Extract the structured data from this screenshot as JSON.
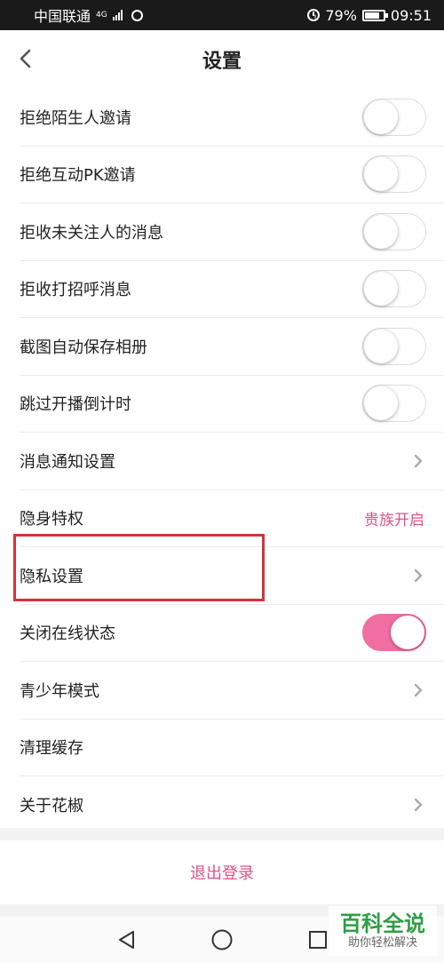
{
  "status_bar": {
    "carrier": "中国联通",
    "network": "4G",
    "battery": "79%",
    "battery_level": 0.79,
    "time": "09:51"
  },
  "header": {
    "title": "设置",
    "back_icon": "chevron-left-icon"
  },
  "settings": [
    {
      "label": "拒绝陌生人邀请",
      "control": "toggle",
      "on": false
    },
    {
      "label": "拒绝互动PK邀请",
      "control": "toggle",
      "on": false
    },
    {
      "label": "拒收未关注人的消息",
      "control": "toggle",
      "on": false
    },
    {
      "label": "拒收打招呼消息",
      "control": "toggle",
      "on": false
    },
    {
      "label": "截图自动保存相册",
      "control": "toggle",
      "on": false
    },
    {
      "label": "跳过开播倒计时",
      "control": "toggle",
      "on": false
    },
    {
      "label": "消息通知设置",
      "control": "chevron"
    },
    {
      "label": "隐身特权",
      "control": "text",
      "value": "贵族开启"
    },
    {
      "label": "隐私设置",
      "control": "chevron",
      "highlighted": true
    },
    {
      "label": "关闭在线状态",
      "control": "toggle",
      "on": true
    },
    {
      "label": "青少年模式",
      "control": "chevron"
    },
    {
      "label": "清理缓存",
      "control": "none"
    },
    {
      "label": "关于花椒",
      "control": "chevron"
    }
  ],
  "logout": {
    "label": "退出登录"
  },
  "nav_bar": {
    "buttons": [
      "back-triangle-icon",
      "home-circle-icon",
      "recents-square-icon"
    ]
  },
  "watermark": {
    "title": "百科全说",
    "subtitle": "助你轻松解决"
  },
  "colors": {
    "accent": "#e0508b",
    "toggle_on": "#f06ea1",
    "highlight": "#d0343c",
    "watermark": "#2f9e44"
  }
}
